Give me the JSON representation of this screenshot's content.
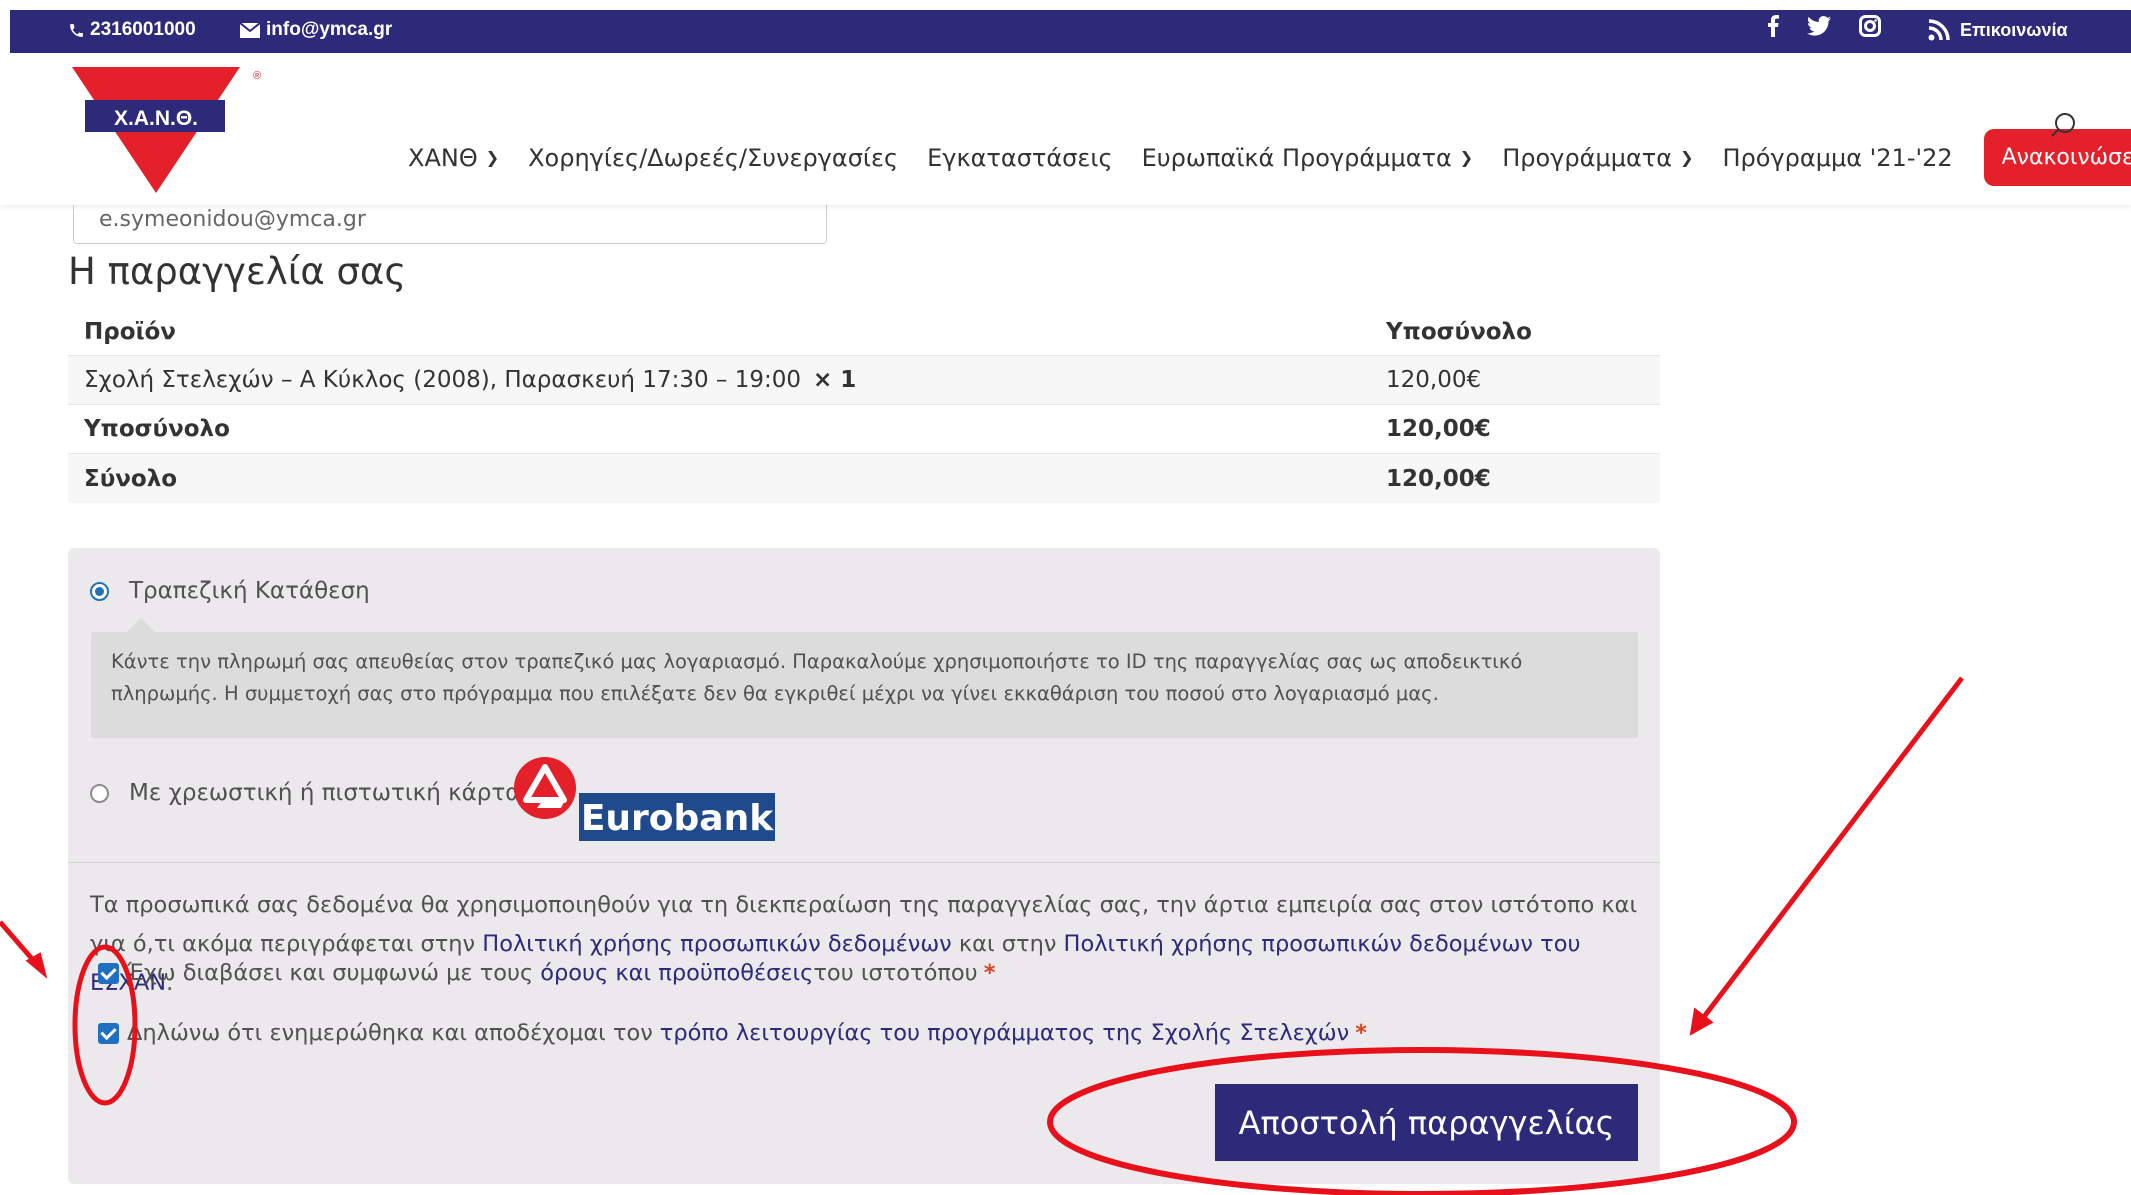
{
  "topbar": {
    "phone": "2316001000",
    "email": "info@ymca.gr",
    "social_icons": [
      "facebook-icon",
      "twitter-icon",
      "instagram-icon"
    ],
    "contact_label": "Επικοινωνία"
  },
  "logo": {
    "text": "Χ.Α.Ν.Θ.",
    "registered": "®"
  },
  "nav": {
    "items": [
      {
        "label": "ΧΑΝΘ",
        "dropdown": true
      },
      {
        "label": "Χορηγίες/Δωρεές/Συνεργασίες",
        "dropdown": false
      },
      {
        "label": "Εγκαταστάσεις",
        "dropdown": false
      },
      {
        "label": "Ευρωπαϊκά Προγράμματα",
        "dropdown": true
      },
      {
        "label": "Προγράμματα",
        "dropdown": true
      },
      {
        "label": "Πρόγραμμα '21-'22",
        "dropdown": false
      }
    ],
    "announce_label": "Ανακοινώσεις"
  },
  "email_field": {
    "value": "e.symeonidou@ymca.gr"
  },
  "order": {
    "title": "Η παραγγελία σας",
    "header": {
      "product": "Προϊόν",
      "subtotal": "Υποσύνολο"
    },
    "items": [
      {
        "name": "Σχολή Στελεχών – Α Κύκλος (2008), Παρασκευή 17:30 – 19:00",
        "qty": "× 1",
        "price": "120,00€"
      }
    ],
    "subtotal_label": "Υποσύνολο",
    "subtotal_value": "120,00€",
    "total_label": "Σύνολο",
    "total_value": "120,00€"
  },
  "payment": {
    "bank_transfer_label": "Τραπεζική Κατάθεση",
    "bank_transfer_selected": true,
    "bank_transfer_desc": "Κάντε την πληρωμή σας απευθείας στον τραπεζικό μας λογαριασμό. Παρακαλούμε χρησιμοποιήστε το ID της παραγγελίας σας ως αποδεικτικό πληρωμής. Η συμμετοχή σας στο πρόγραμμα που επιλέξατε δεν θα εγκριθεί μέχρι να γίνει εκκαθάριση του ποσού στο λογαριασμό μας.",
    "card_label": "Με χρεωστική ή πιστωτική κάρτα",
    "card_selected": false,
    "bank_logo_text": "Eurobank"
  },
  "privacy": {
    "text_1": "Τα προσωπικά σας δεδομένα θα χρησιμοποιηθούν για τη διεκπεραίωση της παραγγελίας σας, την άρτια εμπειρία σας στον ιστότοπο και για ό,τι ακόμα περιγράφεται στην ",
    "link_1": "Πολιτική χρήσης προσωπικών δεδομένων",
    "text_2": " και στην ",
    "link_2": "Πολιτική χρήσης προσωπικών δεδομένων του ΕΣΧΑΝ",
    "text_3": "."
  },
  "terms": {
    "text": "Έχω διαβάσει και συμφωνώ με τους ",
    "link": "όρους και προϋποθέσεις",
    "suffix": " του ιστοτόπου",
    "required": "*",
    "checked": true
  },
  "declaration": {
    "text": "Δηλώνω ότι ενημερώθηκα και αποδέχομαι τον ",
    "link": "τρόπο λειτουργίας του προγράμματος της Σχολής Στελεχών",
    "required": "*",
    "checked": true
  },
  "submit_label": "Αποστολή παραγγελίας",
  "colors": {
    "brand": "#2d2a7a",
    "accent": "#e4202a",
    "annotation": "#e8101a"
  }
}
